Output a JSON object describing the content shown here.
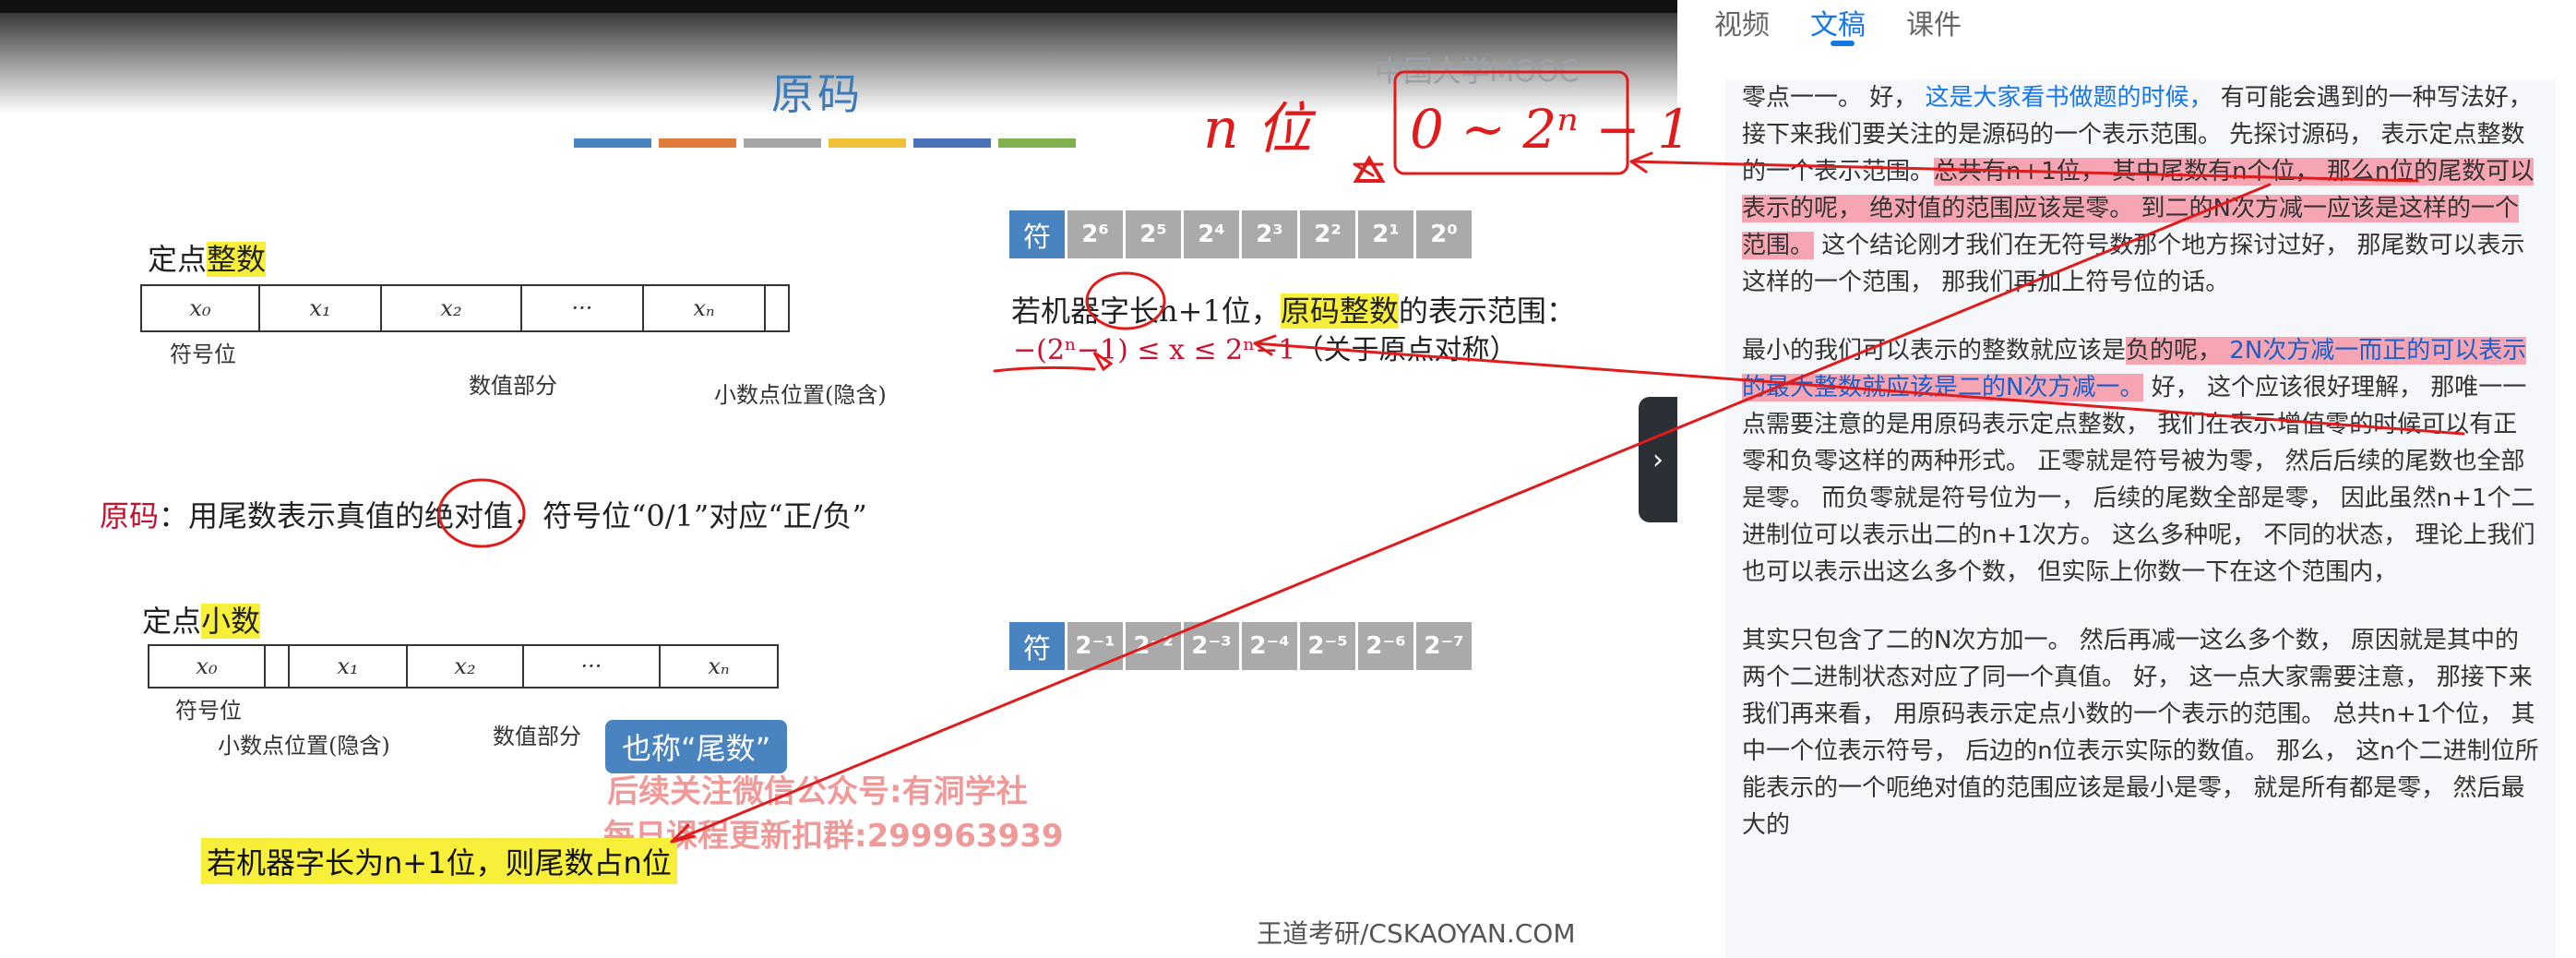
{
  "video": {
    "logo": "中国大学MOOC",
    "slide_title": "原码",
    "color_bars": [
      "#4a84c0",
      "#e07b39",
      "#a6a6a6",
      "#f2c13a",
      "#4a72b8",
      "#7fb24e"
    ],
    "integer_heading_prefix": "定点",
    "integer_heading_highlight": "整数",
    "integer_register_cells": [
      "x₀",
      "x₁",
      "x₂",
      "···",
      "xₙ",
      ""
    ],
    "integer_sign_label": "符号位",
    "integer_value_label": "数值部分",
    "integer_point_label": "小数点位置(隐含)",
    "integer_bits": [
      "符",
      "2⁶",
      "2⁵",
      "2⁴",
      "2³",
      "2²",
      "2¹",
      "2⁰"
    ],
    "range_prefix": "若机器字长",
    "range_circled": "n+1",
    "range_mid": "位，",
    "range_highlight": "原码整数",
    "range_suffix": "的表示范围：",
    "range_formula": "−(2ⁿ−1) ≤ x ≤ 2ⁿ−1",
    "range_note": "（关于原点对称）",
    "def_red": "原码",
    "def_text": "：用尾数表示真值的绝对值，符号位“0/1”对应“正/负”",
    "fraction_heading_prefix": "定点",
    "fraction_heading_highlight": "小数",
    "fraction_register_cells": [
      "x₀",
      "",
      "x₁",
      "x₂",
      "···",
      "xₙ"
    ],
    "fraction_sign_label": "符号位",
    "fraction_point_label": "小数点位置(隐含)",
    "fraction_value_label": "数值部分",
    "fraction_bits": [
      "符",
      "2⁻¹",
      "2⁻²",
      "2⁻³",
      "2⁻⁴",
      "2⁻⁵",
      "2⁻⁶",
      "2⁻⁷"
    ],
    "tail_badge": "也称“尾数”",
    "watermark_line1": "后续关注微信公众号:有洞学社",
    "watermark_line2": "每日课程更新扣群:299963939",
    "bottom_note": "若机器字长为n+1位，则尾数占n位",
    "footer_brand": "王道考研/CSKAOYAN.COM",
    "handwriting_n": "n 位",
    "handwriting_box": "0 ~ 2ⁿ − 1",
    "side_toggle_icon": "›"
  },
  "panel": {
    "tabs": [
      "视频",
      "文稿",
      "课件"
    ],
    "active_tab": 1,
    "paragraphs": [
      {
        "segments": [
          {
            "t": "零点一一。 好， "
          },
          {
            "t": "这是大家看书做题的时候，",
            "s": "blue"
          },
          {
            "t": " 有可能会遇到的一种写法好， 接下来我们要关注的是源码的一个表示范围。 先探讨源码， 表示定点整数的一个表示范围。"
          },
          {
            "t": "总共有n+1位， 其中尾数有n个位， 那么n位的尾数可以表示的呢， 绝对值的范围应该是零。 到二的N次方减一应该是这样的一个范围。",
            "s": "mark"
          },
          {
            "t": " 这个结论刚才我们在无符号数那个地方探讨过好， 那尾数可以表示这样的一个范围， 那我们再加上符号位的话。"
          }
        ]
      },
      {
        "segments": [
          {
            "t": "最小的我们可以表示的整数就应该是"
          },
          {
            "t": "负的呢， ",
            "s": "mark"
          },
          {
            "t": "2N次方减一而正的可以表示的最大整数就应该是二的N次方减一。",
            "s": "markblue"
          },
          {
            "t": " 好， 这个应该很好理解， 那唯一一点需要注意的是用原码表示定点整数， 我们在表示增值零的时候可以有正零和负零这样的两种形式。 正零就是符号被为零， 然后后续的尾数也全部是零。 而负零就是符号位为一， 后续的尾数全部是零， 因此虽然n+1个二进制位可以表示出二的n+1次方。 这么多种呢， 不同的状态， 理论上我们也可以表示出这么多个数， 但实际上你数一下在这个范围内，"
          }
        ]
      },
      {
        "segments": [
          {
            "t": "其实只包含了二的N次方加一。 然后再减一这么多个数， 原因就是其中的两个二进制状态对应了同一个真值。 好， 这一点大家需要注意， 那接下来我们再来看， 用原码表示定点小数的一个表示的范围。 总共n+1个位， 其中一个位表示符号， 后边的n位表示实际的数值。 那么， 这n个二进制位所能表示的一个呃绝对值的范围应该是最小是零， 就是所有都是零， 然后最大的"
          }
        ]
      }
    ]
  }
}
